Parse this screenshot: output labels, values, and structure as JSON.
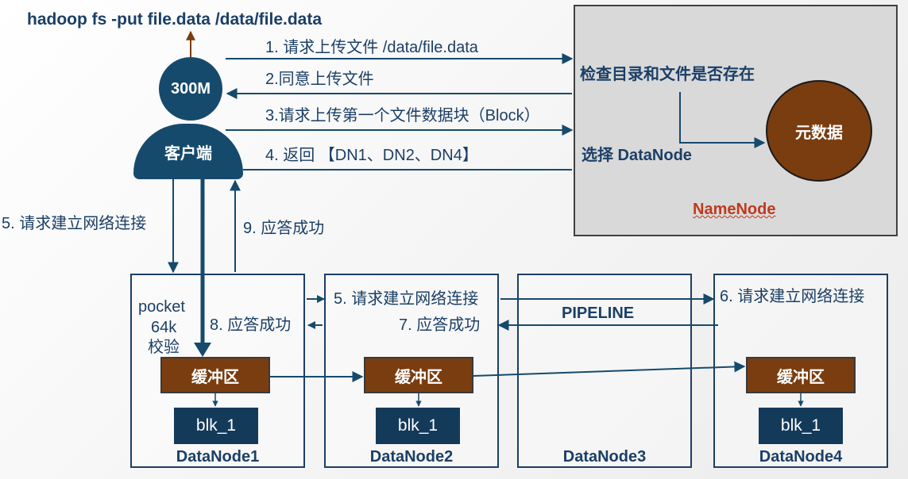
{
  "command": "hadoop fs -put file.data /data/file.data",
  "client": {
    "file_size": "300M",
    "label": "客户端",
    "packet_lines": [
      "pocket",
      "64k",
      "校验"
    ]
  },
  "namenode": {
    "label": "NameNode",
    "check_text": "检查目录和文件是否存在",
    "select_text": "选择 DataNode",
    "metadata_label": "元数据"
  },
  "messages": {
    "step1": "1. 请求上传文件 /data/file.data",
    "step2": "2.同意上传文件",
    "step3": "3.请求上传第一个文件数据块（Block）",
    "step4": "4. 返回 【DN1、DN2、DN4】",
    "step5_client": "5. 请求建立网络连接",
    "step9": "9. 应答成功",
    "step5_dn": "5. 请求建立网络连接",
    "step6": "6. 请求建立网络连接",
    "step7": "7. 应答成功",
    "step8": "8. 应答成功",
    "pipeline": "PIPELINE"
  },
  "datanodes": [
    {
      "name": "DataNode1",
      "buffer": "缓冲区",
      "block": "blk_1"
    },
    {
      "name": "DataNode2",
      "buffer": "缓冲区",
      "block": "blk_1"
    },
    {
      "name": "DataNode3"
    },
    {
      "name": "DataNode4",
      "buffer": "缓冲区",
      "block": "blk_1"
    }
  ],
  "colors": {
    "navy": "#164a6c",
    "text": "#1b3f66",
    "brown": "#7a3d10",
    "namenode_bg": "#d9d9d9",
    "namenode_label": "#c0391b"
  }
}
